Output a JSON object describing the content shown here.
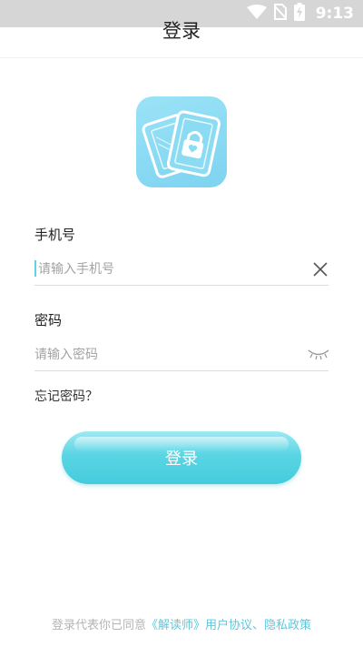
{
  "status_bar": {
    "time": "9:13",
    "icons": [
      "wifi-icon",
      "no-sim-icon",
      "battery-charging-icon"
    ]
  },
  "header": {
    "title": "登录"
  },
  "logo": {
    "icon": "app-logo-lock-cards",
    "color": "#8ad9f3"
  },
  "form": {
    "phone": {
      "label": "手机号",
      "placeholder": "请输入手机号",
      "value": "",
      "clear_icon": "close-icon"
    },
    "password": {
      "label": "密码",
      "placeholder": "请输入密码",
      "value": "",
      "toggle_icon": "eye-closed-icon"
    },
    "forgot_label": "忘记密码？",
    "submit_label": "登录"
  },
  "footer": {
    "prefix": "登录代表你已同意",
    "link1": "《解读师》用户协议",
    "separator": "、",
    "link2": "隐私政策"
  },
  "colors": {
    "accent": "#52d1e2",
    "link": "#5cc8dc",
    "status_bar": "#d6d6d6"
  }
}
